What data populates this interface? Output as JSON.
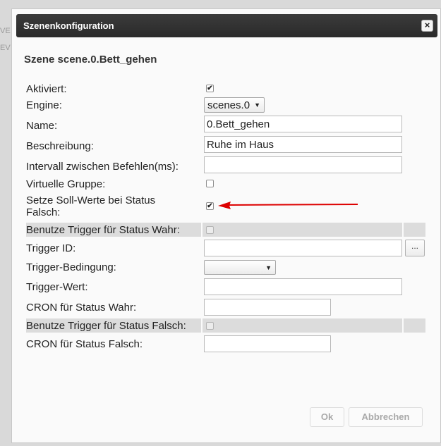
{
  "background": {
    "fragment_1": "VE",
    "fragment_2": "EV"
  },
  "dialog": {
    "title": "Szenenkonfiguration",
    "close_label": "×",
    "scene_title": "Szene scene.0.Bett_gehen"
  },
  "form": {
    "aktiviert_label": "Aktiviert:",
    "aktiviert_checked": true,
    "engine_label": "Engine:",
    "engine_value": "scenes.0",
    "name_label": "Name:",
    "name_value": "0.Bett_gehen",
    "beschreibung_label": "Beschreibung:",
    "beschreibung_value": "Ruhe im Haus",
    "intervall_label": "Intervall zwischen Befehlen(ms):",
    "intervall_value": "",
    "virtuelle_gruppe_label": "Virtuelle Gruppe:",
    "virtuelle_gruppe_checked": false,
    "setze_soll_label_line1": "Setze Soll-Werte bei Status",
    "setze_soll_label_line2": "Falsch:",
    "setze_soll_checked": true,
    "trigger_wahr_label": "Benutze Trigger für Status Wahr:",
    "trigger_wahr_checked": false,
    "trigger_id_label": "Trigger ID:",
    "trigger_id_value": "",
    "trigger_id_button": "...",
    "trigger_bedingung_label": "Trigger-Bedingung:",
    "trigger_bedingung_value": "",
    "trigger_wert_label": "Trigger-Wert:",
    "trigger_wert_value": "",
    "cron_wahr_label": "CRON für Status Wahr:",
    "cron_wahr_value": "",
    "trigger_falsch_label": "Benutze Trigger für Status Falsch:",
    "trigger_falsch_checked": false,
    "cron_falsch_label": "CRON für Status Falsch:",
    "cron_falsch_value": ""
  },
  "buttons": {
    "ok_label": "Ok",
    "cancel_label": "Abbrechen"
  },
  "check_glyph": "✔",
  "dropdown_glyph": "▼",
  "colors": {
    "titlebar": "#2f2f2f",
    "annotation_arrow": "#dd0000",
    "band": "#dcdcdc"
  }
}
